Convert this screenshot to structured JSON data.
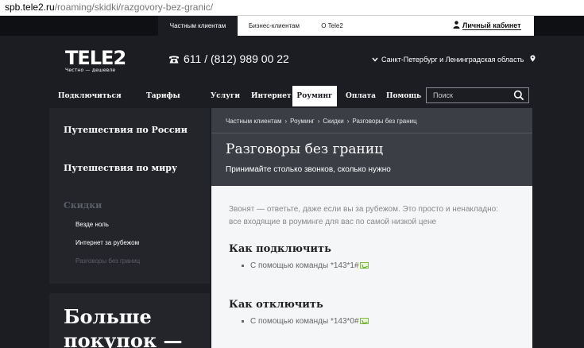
{
  "browser": {
    "url_host": "spb.tele2.ru",
    "url_path": "/roaming/skidki/razgovory-bez-granic/"
  },
  "top_nav": {
    "items": [
      {
        "label": "Частным клиентам",
        "active": true
      },
      {
        "label": "Бизнес-клиентам",
        "active": false
      },
      {
        "label": "О Tele2",
        "active": false
      }
    ],
    "cabinet_label": "Личный кабинет",
    "cabinet_icon": "person-icon"
  },
  "header": {
    "logo_text": "TELE2",
    "slogan": "Честно — дешевле",
    "phone_icon": "phone-icon",
    "phone": "611 / (812) 989 00 22",
    "region": "Санкт-Петербург и Ленинградская область",
    "region_icon": "map-pin-icon"
  },
  "main_nav": {
    "items": [
      {
        "label": "Подключиться",
        "active": false
      },
      {
        "label": "Тарифы",
        "active": false
      },
      {
        "label": "Услуги",
        "active": false
      },
      {
        "label": "Интернет",
        "active": false
      },
      {
        "label": "Роуминг",
        "active": true
      },
      {
        "label": "Оплата",
        "active": false
      },
      {
        "label": "Помощь",
        "active": false
      }
    ],
    "search_placeholder": "Поиск"
  },
  "sidebar": {
    "sections": [
      "Путешествия по России",
      "Путешествия по миру"
    ],
    "discounts_heading": "Скидки",
    "discounts": [
      {
        "label": "Везде ноль",
        "current": false
      },
      {
        "label": "Интернет за рубежом",
        "current": false
      },
      {
        "label": "Разговоры без границ",
        "current": true
      }
    ],
    "promo_line1": "Больше",
    "promo_line2": "покупок —"
  },
  "content": {
    "breadcrumbs": [
      "Частным клиентам",
      "Роуминг",
      "Скидки",
      "Разговоры без границ"
    ],
    "title": "Разговоры без границ",
    "subtitle": "Принимайте столько звонков, сколько нужно",
    "intro_line1": "Звонят — ответьте, даже если вы за рубежом. Это просто и ненакладно:",
    "intro_line2": "все входящие в роуминге для вас по самой низкой цене",
    "connect_heading": "Как подключить",
    "connect_item": "С помощью команды *143*1#",
    "disconnect_heading": "Как отключить",
    "disconnect_item": "С помощью команды *143*0#"
  },
  "colors": {
    "bg_dark": "#1b1d22",
    "hero": "#3b3e45",
    "sidebar": "#23252b",
    "content_bg": "#f5f6f7",
    "call_icon": "#7fbf3f"
  }
}
